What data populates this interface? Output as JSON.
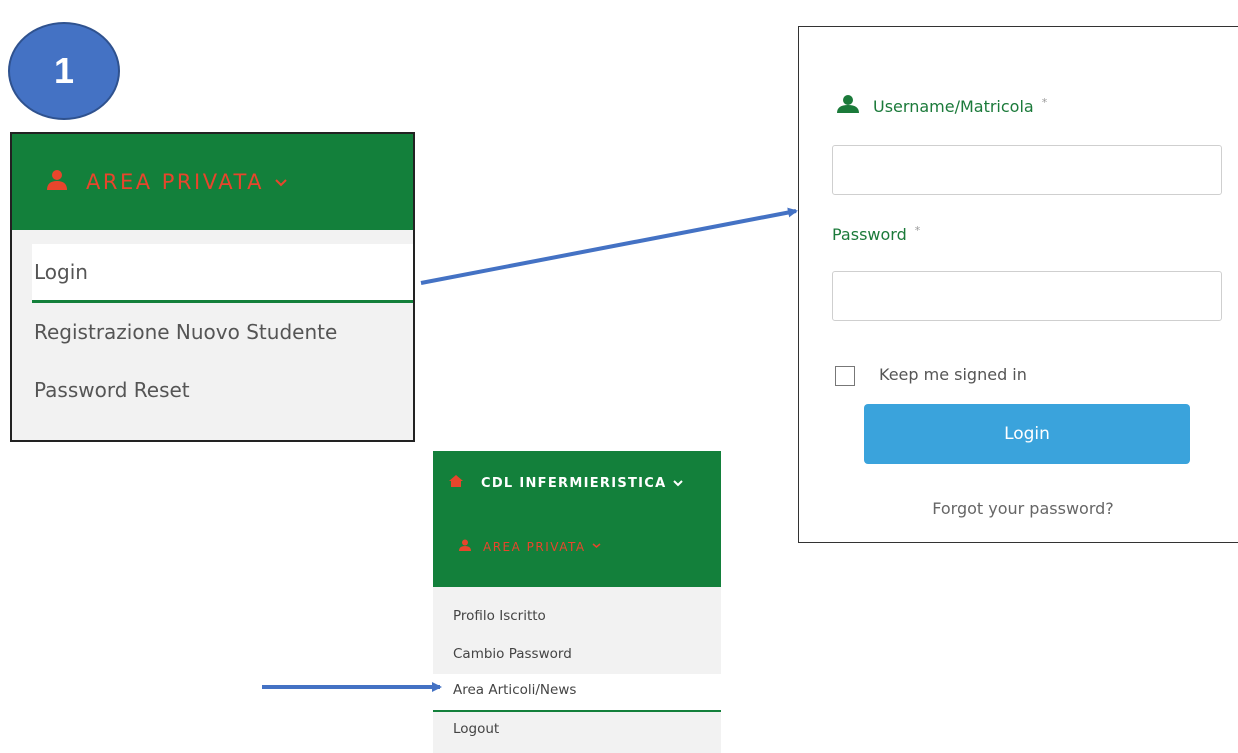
{
  "step": {
    "number": "1"
  },
  "area_privata_menu": {
    "header": "AREA PRIVATA",
    "items": [
      {
        "label": "Login",
        "active": true
      },
      {
        "label": "Registrazione Nuovo Studente",
        "active": false
      },
      {
        "label": "Password Reset",
        "active": false
      }
    ]
  },
  "login_form": {
    "username_label": "Username/Matricola",
    "password_label": "Password",
    "required_mark": "*",
    "keep_signed_in": "Keep me signed in",
    "keep_signed_in_checked": false,
    "login_button": "Login",
    "forgot_link": "Forgot your password?"
  },
  "logged_menu": {
    "site": "CDL INFERMIERISTICA",
    "area": "AREA PRIVATA",
    "items": [
      {
        "label": "Profilo Iscritto",
        "active": false
      },
      {
        "label": "Cambio Password",
        "active": false
      },
      {
        "label": "Area Articoli/News",
        "active": true
      },
      {
        "label": "Logout",
        "active": false
      }
    ]
  },
  "colors": {
    "green": "#13803b",
    "red_accent": "#e8452c",
    "button_blue": "#3aa3dc",
    "arrow_blue": "#4472c4"
  }
}
